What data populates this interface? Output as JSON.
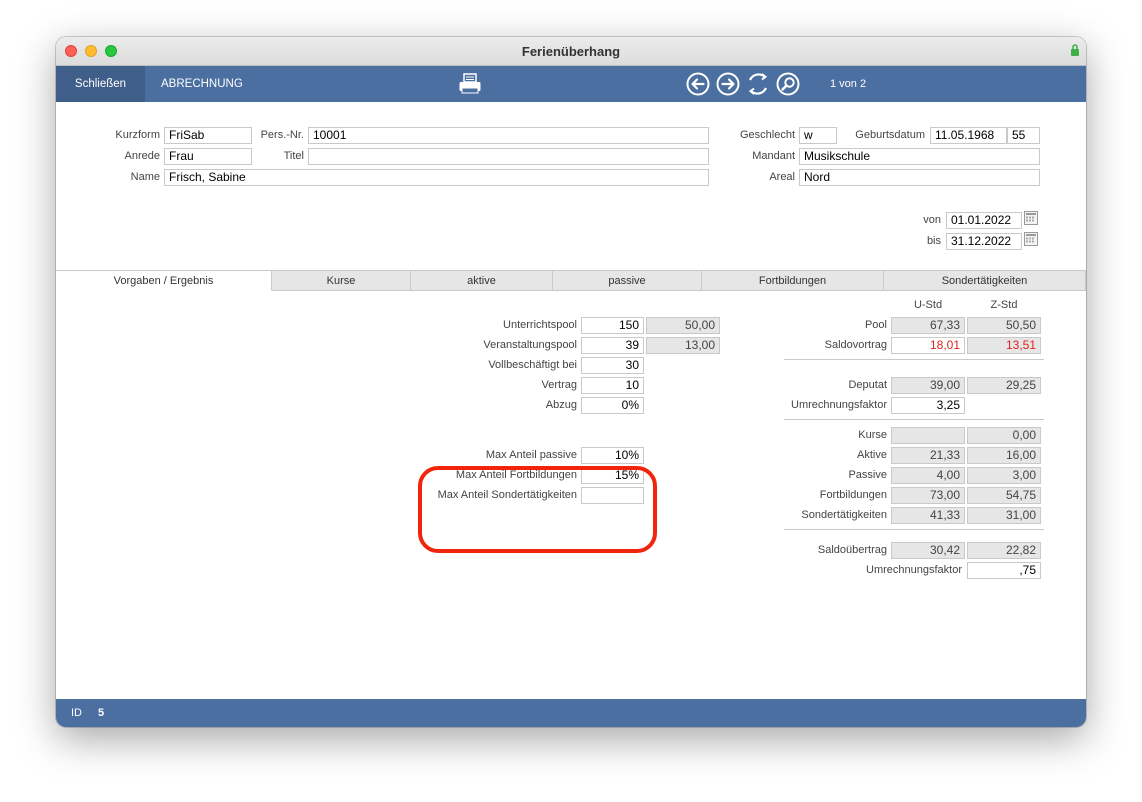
{
  "window": {
    "title": "Ferienüberhang"
  },
  "toolbar": {
    "close_label": "Schließen",
    "abrechnung_label": "ABRECHNUNG",
    "record_count": "1 von 2"
  },
  "person": {
    "kurzform_label": "Kurzform",
    "kurzform": "FriSab",
    "persnr_label": "Pers.-Nr.",
    "persnr": "10001",
    "anrede_label": "Anrede",
    "anrede": "Frau",
    "titel_label": "Titel",
    "titel": "",
    "name_label": "Name",
    "name": "Frisch, Sabine",
    "geschlecht_label": "Geschlecht",
    "geschlecht": "w",
    "geburtsdatum_label": "Geburtsdatum",
    "geburtsdatum": "11.05.1968",
    "alter": "55",
    "mandant_label": "Mandant",
    "mandant": "Musikschule",
    "areal_label": "Areal",
    "areal": "Nord"
  },
  "period": {
    "von_label": "von",
    "von": "01.01.2022",
    "bis_label": "bis",
    "bis": "31.12.2022"
  },
  "tabs": [
    {
      "label": "Vorgaben / Ergebnis"
    },
    {
      "label": "Kurse"
    },
    {
      "label": "aktive"
    },
    {
      "label": "passive"
    },
    {
      "label": "Fortbildungen"
    },
    {
      "label": "Sondertätigkeiten"
    }
  ],
  "vorgaben": {
    "unterrichtspool_label": "Unterrichtspool",
    "unterrichtspool": "150",
    "unterrichtspool_z": "50,00",
    "veranstaltungspool_label": "Veranstaltungspool",
    "veranstaltungspool": "39",
    "veranstaltungspool_z": "13,00",
    "vollbeschaeftigt_label": "Vollbeschäftigt bei",
    "vollbeschaeftigt": "30",
    "vertrag_label": "Vertrag",
    "vertrag": "10",
    "abzug_label": "Abzug",
    "abzug": "0%",
    "max_passive_label": "Max Anteil passive",
    "max_passive": "10%",
    "max_fortbildungen_label": "Max Anteil Fortbildungen",
    "max_fortbildungen": "15%",
    "max_sonder_label": "Max Anteil Sondertätigkeiten",
    "max_sonder": ""
  },
  "ergebnis": {
    "col_u": "U-Std",
    "col_z": "Z-Std",
    "pool_label": "Pool",
    "pool_u": "67,33",
    "pool_z": "50,50",
    "saldovortrag_label": "Saldovortrag",
    "saldovortrag_u": "18,01",
    "saldovortrag_z": "13,51",
    "deputat_label": "Deputat",
    "deputat_u": "39,00",
    "deputat_z": "29,25",
    "umrechnung1_label": "Umrechnungsfaktor",
    "umrechnung1": "3,25",
    "kurse_label": "Kurse",
    "kurse_u": "",
    "kurse_z": "0,00",
    "aktive_label": "Aktive",
    "aktive_u": "21,33",
    "aktive_z": "16,00",
    "passive_label": "Passive",
    "passive_u": "4,00",
    "passive_z": "3,00",
    "fortbildungen_label": "Fortbildungen",
    "fortbildungen_u": "73,00",
    "fortbildungen_z": "54,75",
    "sonder_label": "Sondertätigkeiten",
    "sonder_u": "41,33",
    "sonder_z": "31,00",
    "saldouebertrag_label": "Saldoübertrag",
    "saldouebertrag_u": "30,42",
    "saldouebertrag_z": "22,82",
    "umrechnung2_label": "Umrechnungsfaktor",
    "umrechnung2": ",75"
  },
  "status": {
    "id_label": "ID",
    "id_value": "5"
  },
  "colors": {
    "toolbar": "#4a6fa0",
    "highlight": "#f0250c",
    "negative": "#e0201c"
  }
}
